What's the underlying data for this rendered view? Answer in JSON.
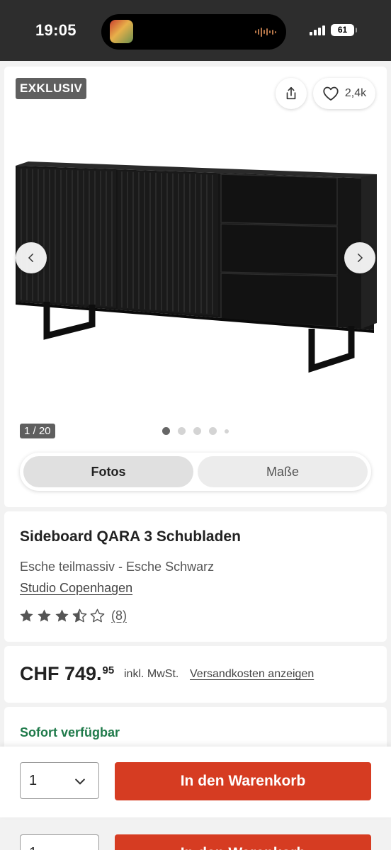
{
  "status_bar": {
    "time": "19:05",
    "battery": "61"
  },
  "gallery": {
    "badge": "EXKLUSIV",
    "like_count": "2,4k",
    "counter": "1 / 20",
    "tabs": [
      {
        "label": "Fotos",
        "active": true
      },
      {
        "label": "Maße",
        "active": false
      }
    ]
  },
  "product": {
    "title": "Sideboard QARA 3 Schubladen",
    "material": "Esche teilmassiv - Esche Schwarz",
    "brand": "Studio Copenhagen",
    "rating": 3.5,
    "rating_count": "(8)"
  },
  "price": {
    "main": "CHF 749.",
    "cents": "95",
    "vat": "inkl. MwSt.",
    "shipping_link": "Versandkosten anzeigen"
  },
  "availability": {
    "status": "Sofort verfügbar",
    "color": "#1f7a4a"
  },
  "cart": {
    "quantity": "1",
    "button_label": "In den Warenkorb",
    "button_color": "#d63c22"
  },
  "icons": {
    "share": "share-icon",
    "like": "heart-icon",
    "prev": "chevron-left-icon",
    "next": "chevron-right-icon",
    "quantity": "chevron-down-icon"
  }
}
